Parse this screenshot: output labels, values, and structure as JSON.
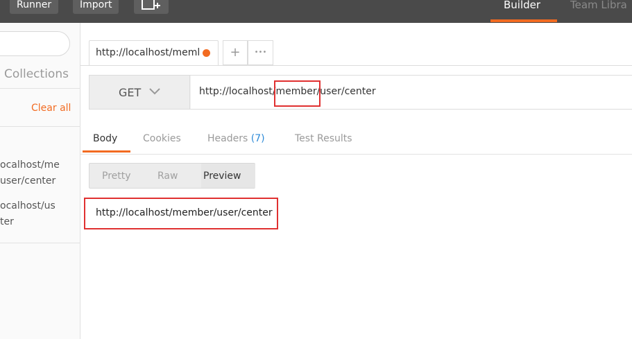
{
  "header": {
    "runner_label": "Runner",
    "import_label": "Import",
    "builder_label": "Builder",
    "team_library_label": "Team Libra"
  },
  "sidebar": {
    "collections_label": "Collections",
    "clear_all_label": "Clear all",
    "history": [
      {
        "line1": "ocalhost/me",
        "line2": "user/center"
      },
      {
        "line1": "ocalhost/us",
        "line2": "ter"
      }
    ]
  },
  "request_tab": {
    "label": "http://localhost/meml",
    "add_label": "+",
    "more_label": "•••"
  },
  "request": {
    "method": "GET",
    "url": "http://localhost/member/user/center"
  },
  "response_tabs": [
    {
      "label": "Body"
    },
    {
      "label": "Cookies"
    },
    {
      "label": "Headers",
      "count": "(7)"
    },
    {
      "label": "Test Results"
    }
  ],
  "view_modes": [
    "Pretty",
    "Raw",
    "Preview"
  ],
  "response_body": "http://localhost/member/user/center",
  "colors": {
    "accent": "#f26b21",
    "highlight_box": "#e03030",
    "count": "#2e8bd8"
  }
}
